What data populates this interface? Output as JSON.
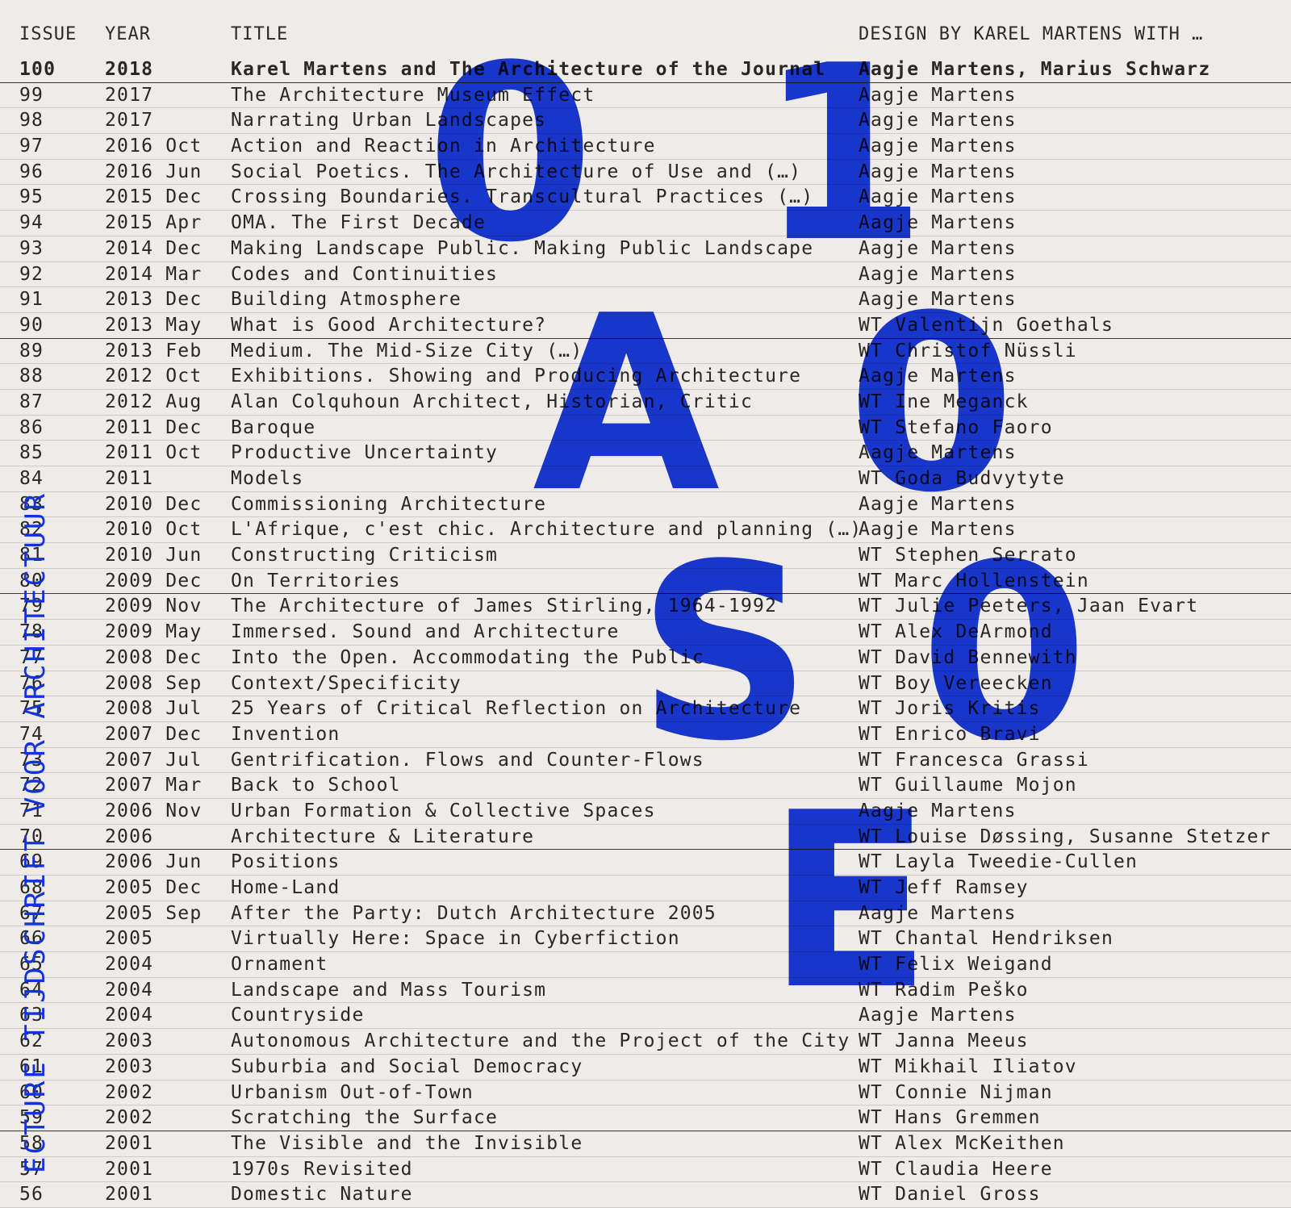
{
  "headers": {
    "issue": "ISSUE",
    "year": "YEAR",
    "title": "TITLE",
    "designer": "DESIGN BY KAREL MARTENS WITH …"
  },
  "spine_text": "ECTURE  TIJDSCHRIFT VOOR ARCHITECTUUR",
  "logo": {
    "letters": [
      "0",
      "1",
      "A",
      "0",
      "S",
      "0",
      "E"
    ],
    "color": "#1133dd"
  },
  "rows": [
    {
      "issue": "100",
      "year": "2018",
      "title": "Karel Martens and The Architecture of the Journal",
      "designer": "Aagje Martens, Marius Schwarz"
    },
    {
      "issue": "99",
      "year": "2017",
      "title": "The Architecture Museum Effect",
      "designer": "Aagje Martens"
    },
    {
      "issue": "98",
      "year": "2017",
      "title": "Narrating Urban Landscapes",
      "designer": "Aagje Martens"
    },
    {
      "issue": "97",
      "year": "2016 Oct",
      "title": "Action and Reaction in Architecture",
      "designer": "Aagje Martens"
    },
    {
      "issue": "96",
      "year": "2016 Jun",
      "title": "Social Poetics. The Architecture of Use and (…)",
      "designer": "Aagje Martens"
    },
    {
      "issue": "95",
      "year": "2015 Dec",
      "title": "Crossing Boundaries. Transcultural Practices (…)",
      "designer": "Aagje Martens"
    },
    {
      "issue": "94",
      "year": "2015 Apr",
      "title": "OMA. The First Decade",
      "designer": "Aagje Martens"
    },
    {
      "issue": "93",
      "year": "2014 Dec",
      "title": "Making Landscape Public. Making Public Landscape",
      "designer": "Aagje Martens"
    },
    {
      "issue": "92",
      "year": "2014 Mar",
      "title": "Codes and Continuities",
      "designer": "Aagje Martens"
    },
    {
      "issue": "91",
      "year": "2013 Dec",
      "title": "Building Atmosphere",
      "designer": "Aagje Martens"
    },
    {
      "issue": "90",
      "year": "2013 May",
      "title": "What is Good Architecture?",
      "designer": "WT Valentijn Goethals"
    },
    {
      "issue": "89",
      "year": "2013 Feb",
      "title": "Medium. The Mid-Size City (…)",
      "designer": "WT Christof Nüssli"
    },
    {
      "issue": "88",
      "year": "2012 Oct",
      "title": "Exhibitions. Showing and Producing Architecture",
      "designer": "Aagje Martens"
    },
    {
      "issue": "87",
      "year": "2012 Aug",
      "title": "Alan Colquhoun Architect, Historian, Critic",
      "designer": "WT Ine Meganck"
    },
    {
      "issue": "86",
      "year": "2011 Dec",
      "title": "Baroque",
      "designer": "WT Stefano Faoro"
    },
    {
      "issue": "85",
      "year": "2011 Oct",
      "title": "Productive Uncertainty",
      "designer": "Aagje Martens"
    },
    {
      "issue": "84",
      "year": "2011",
      "title": "Models",
      "designer": "WT Goda Budvytyte"
    },
    {
      "issue": "83",
      "year": "2010 Dec",
      "title": "Commissioning Architecture",
      "designer": "Aagje Martens"
    },
    {
      "issue": "82",
      "year": "2010 Oct",
      "title": "L'Afrique, c'est chic. Architecture and planning (…)",
      "designer": "Aagje Martens"
    },
    {
      "issue": "81",
      "year": "2010 Jun",
      "title": "Constructing Criticism",
      "designer": "WT Stephen Serrato"
    },
    {
      "issue": "80",
      "year": "2009 Dec",
      "title": "On Territories",
      "designer": "WT Marc Hollenstein"
    },
    {
      "issue": "79",
      "year": "2009 Nov",
      "title": "The Architecture of James Stirling, 1964-1992",
      "designer": "WT Julie Peeters, Jaan Evart"
    },
    {
      "issue": "78",
      "year": "2009 May",
      "title": "Immersed. Sound and Architecture",
      "designer": "WT Alex DeArmond"
    },
    {
      "issue": "77",
      "year": "2008 Dec",
      "title": "Into the Open. Accommodating the Public",
      "designer": "WT David Bennewith"
    },
    {
      "issue": "76",
      "year": "2008 Sep",
      "title": "Context/Specificity",
      "designer": "WT Boy Vereecken"
    },
    {
      "issue": "75",
      "year": "2008 Jul",
      "title": "25 Years of Critical Reflection on Architecture",
      "designer": "WT Joris Kritis"
    },
    {
      "issue": "74",
      "year": "2007 Dec",
      "title": "Invention",
      "designer": "WT Enrico Bravi"
    },
    {
      "issue": "73",
      "year": "2007 Jul",
      "title": "Gentrification. Flows and Counter-Flows",
      "designer": "WT Francesca Grassi"
    },
    {
      "issue": "72",
      "year": "2007 Mar",
      "title": "Back to School",
      "designer": "WT Guillaume Mojon"
    },
    {
      "issue": "71",
      "year": "2006 Nov",
      "title": "Urban Formation & Collective Spaces",
      "designer": "Aagje Martens"
    },
    {
      "issue": "70",
      "year": "2006",
      "title": "Architecture & Literature",
      "designer": "WT Louise Døssing, Susanne Stetzer"
    },
    {
      "issue": "69",
      "year": "2006 Jun",
      "title": "Positions",
      "designer": "WT Layla Tweedie-Cullen"
    },
    {
      "issue": "68",
      "year": "2005 Dec",
      "title": "Home-Land",
      "designer": "WT Jeff Ramsey"
    },
    {
      "issue": "67",
      "year": "2005 Sep",
      "title": "After the Party: Dutch Architecture 2005",
      "designer": "Aagje Martens"
    },
    {
      "issue": "66",
      "year": "2005",
      "title": "Virtually Here: Space in Cyberfiction",
      "designer": "WT Chantal Hendriksen"
    },
    {
      "issue": "65",
      "year": "2004",
      "title": "Ornament",
      "designer": "WT Felix Weigand"
    },
    {
      "issue": "64",
      "year": "2004",
      "title": "Landscape and Mass Tourism",
      "designer": "WT Radim Peško"
    },
    {
      "issue": "63",
      "year": "2004",
      "title": "Countryside",
      "designer": "Aagje Martens"
    },
    {
      "issue": "62",
      "year": "2003",
      "title": "Autonomous Architecture and the Project of the City",
      "designer": "WT Janna Meeus"
    },
    {
      "issue": "61",
      "year": "2003",
      "title": "Suburbia and Social Democracy",
      "designer": "WT Mikhail Iliatov"
    },
    {
      "issue": "60",
      "year": "2002",
      "title": "Urbanism Out-of-Town",
      "designer": "WT Connie Nijman"
    },
    {
      "issue": "59",
      "year": "2002",
      "title": "Scratching the Surface",
      "designer": "WT Hans Gremmen"
    },
    {
      "issue": "58",
      "year": "2001",
      "title": "The Visible and the Invisible",
      "designer": "WT Alex McKeithen"
    },
    {
      "issue": "57",
      "year": "2001",
      "title": "1970s Revisited",
      "designer": "WT Claudia Heere"
    },
    {
      "issue": "56",
      "year": "2001",
      "title": "Domestic Nature",
      "designer": "WT Daniel Gross"
    }
  ]
}
